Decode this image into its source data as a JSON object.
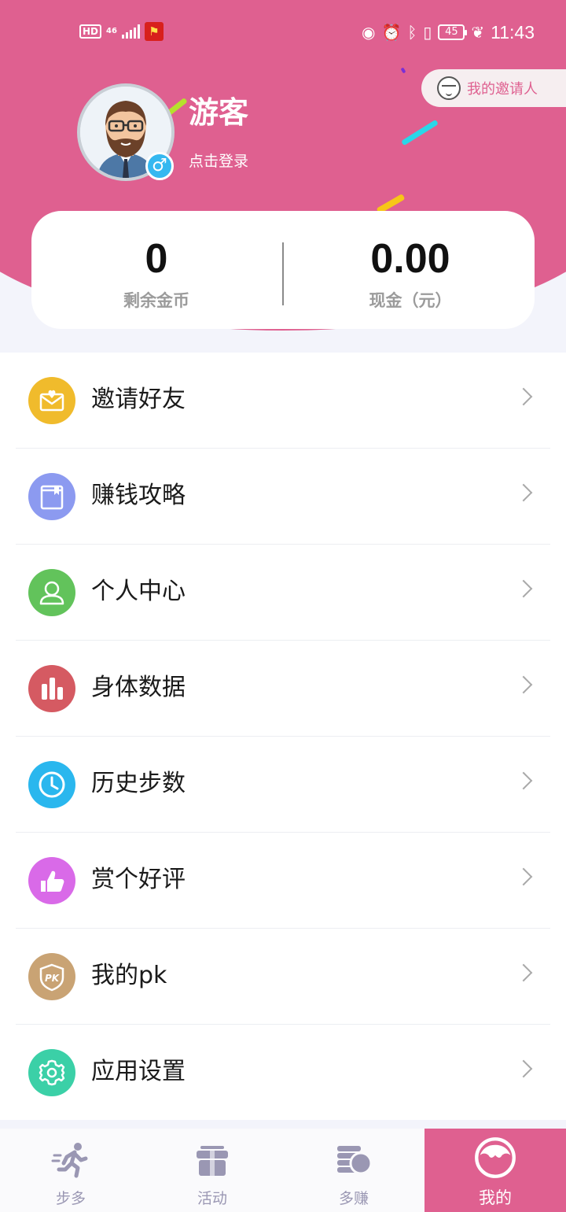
{
  "status_bar": {
    "hd": "HD",
    "network": "46",
    "battery": "45",
    "time": "11:43"
  },
  "header": {
    "inviter_label": "我的邀请人",
    "username": "游客",
    "login_link": "点击登录",
    "gender_symbol": "♂"
  },
  "balance": {
    "coins_value": "0",
    "coins_label": "剩余金币",
    "cash_value": "0.00",
    "cash_label": "现金（元）"
  },
  "menu": {
    "items": [
      {
        "label": "邀请好友",
        "icon": "invite-envelope-icon",
        "color": "#f0bb2c"
      },
      {
        "label": "赚钱攻略",
        "icon": "book-icon",
        "color": "#8c9af0"
      },
      {
        "label": "个人中心",
        "icon": "person-icon",
        "color": "#62c35b"
      },
      {
        "label": "身体数据",
        "icon": "bar-chart-icon",
        "color": "#d55a62"
      },
      {
        "label": "历史步数",
        "icon": "clock-icon",
        "color": "#2ab7ee"
      },
      {
        "label": "赏个好评",
        "icon": "thumbs-up-icon",
        "color": "#d96ae8"
      },
      {
        "label": "我的pk",
        "icon": "pk-shield-icon",
        "color": "#c9a374"
      },
      {
        "label": "应用设置",
        "icon": "gear-icon",
        "color": "#3bd0a7"
      }
    ]
  },
  "tabbar": {
    "tabs": [
      {
        "label": "步多",
        "icon": "runner-icon"
      },
      {
        "label": "活动",
        "icon": "gift-box-icon"
      },
      {
        "label": "多赚",
        "icon": "coins-icon"
      },
      {
        "label": "我的",
        "icon": "profile-face-icon",
        "active": true
      }
    ]
  },
  "colors": {
    "brand_pink": "#df6090",
    "tab_inactive": "#9a97b3"
  }
}
